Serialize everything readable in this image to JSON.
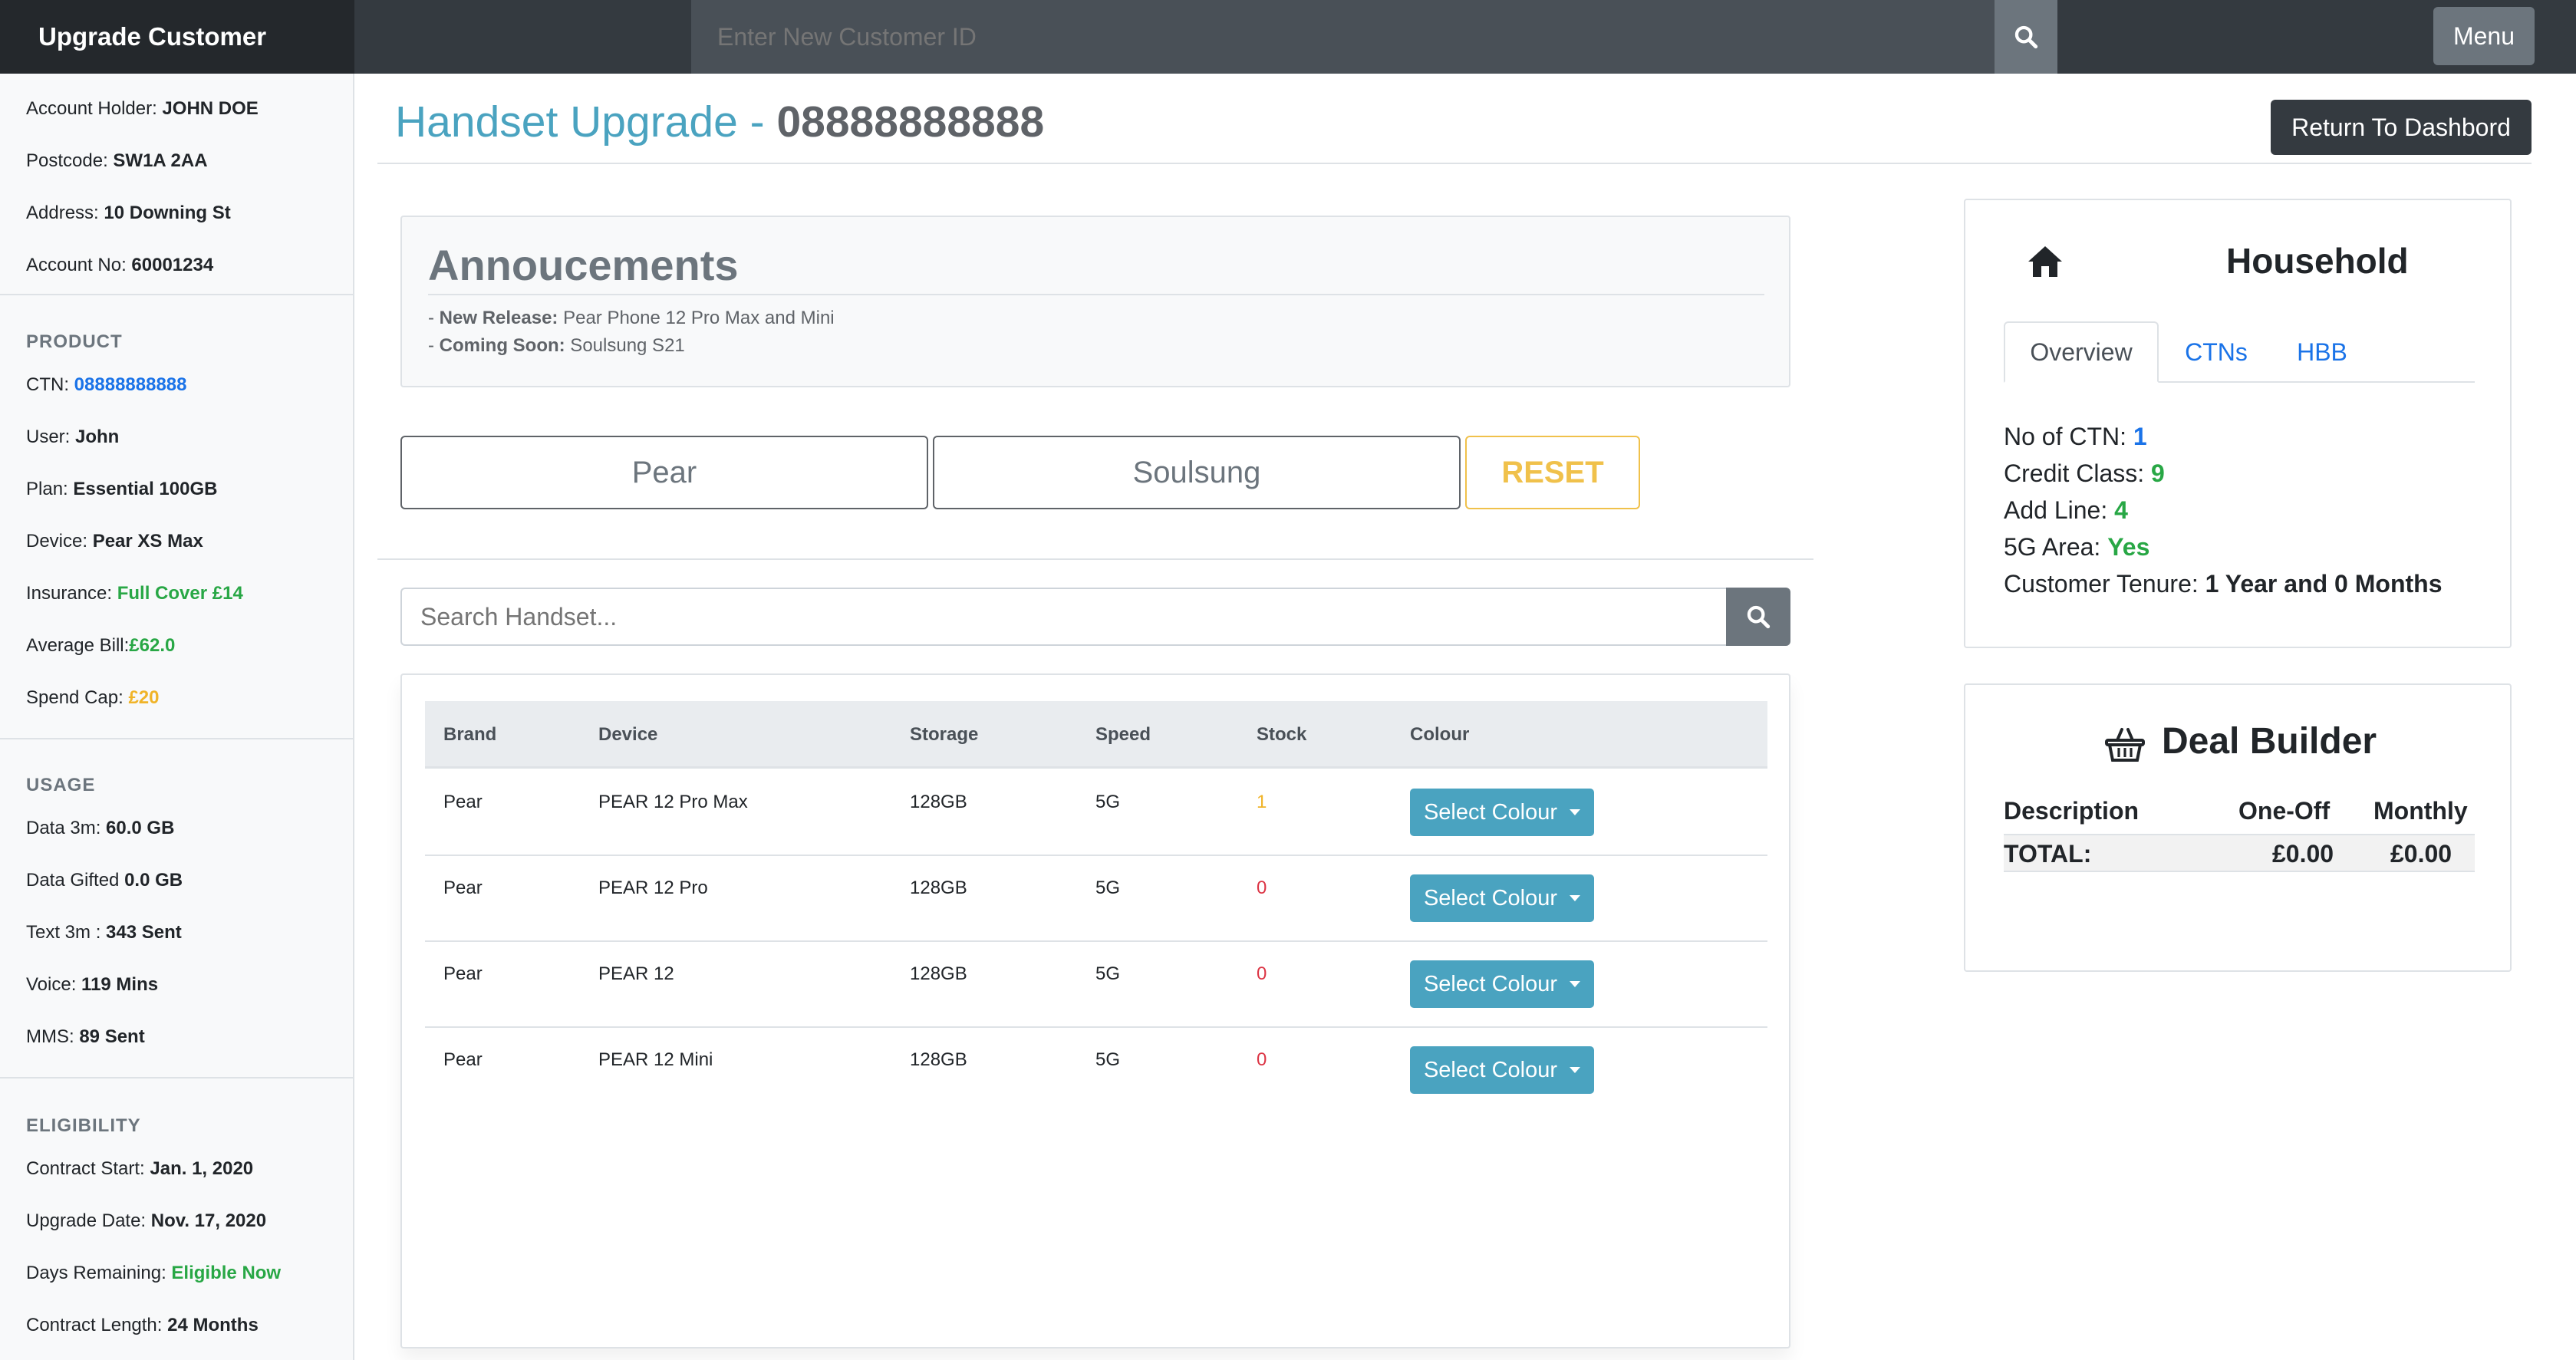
{
  "navbar": {
    "brand": "Upgrade Customer",
    "search_placeholder": "Enter New Customer ID",
    "menu_label": "Menu"
  },
  "sidebar": {
    "account": [
      {
        "label": "Account Holder: ",
        "value": "JOHN DOE"
      },
      {
        "label": "Postcode: ",
        "value": "SW1A 2AA"
      },
      {
        "label": "Address: ",
        "value": "10 Downing St"
      },
      {
        "label": "Account No: ",
        "value": "60001234"
      }
    ],
    "product_heading": "PRODUCT",
    "product": [
      {
        "label": "CTN: ",
        "value": "08888888888"
      },
      {
        "label": "User: ",
        "value": "John"
      },
      {
        "label": "Plan: ",
        "value": "Essential 100GB"
      },
      {
        "label": "Device: ",
        "value": "Pear XS Max"
      },
      {
        "label": "Insurance: ",
        "value": "Full Cover £14"
      },
      {
        "label": "Average Bill:",
        "value": "£62.0"
      },
      {
        "label": "Spend Cap: ",
        "value": "£20"
      }
    ],
    "usage_heading": "USAGE",
    "usage": [
      {
        "label": "Data 3m: ",
        "value": "60.0 GB"
      },
      {
        "label": "Data Gifted ",
        "value": "0.0 GB"
      },
      {
        "label": "Text 3m : ",
        "value": "343 Sent"
      },
      {
        "label": "Voice: ",
        "value": "119 Mins"
      },
      {
        "label": "MMS: ",
        "value": "89 Sent"
      }
    ],
    "eligibility_heading": "ELIGIBILITY",
    "eligibility": [
      {
        "label": "Contract Start: ",
        "value": "Jan. 1, 2020"
      },
      {
        "label": "Upgrade Date: ",
        "value": "Nov. 17, 2020"
      },
      {
        "label": "Days Remaining: ",
        "value": "Eligible Now"
      },
      {
        "label": "Contract Length: ",
        "value": "24 Months"
      }
    ]
  },
  "header": {
    "title_prefix": "Handset Upgrade - ",
    "title_number": "08888888888",
    "return_label": "Return To Dashbord"
  },
  "announcements": {
    "title": "Annoucements",
    "lines": [
      {
        "prefix": "- ",
        "label": "New Release:",
        "text": " Pear Phone 12 Pro Max and Mini"
      },
      {
        "prefix": "- ",
        "label": "Coming Soon:",
        "text": " Soulsung S21"
      }
    ]
  },
  "brand_filters": {
    "pear": "Pear",
    "soulsung": "Soulsung",
    "reset": "RESET"
  },
  "handset_search": {
    "placeholder": "Search Handset..."
  },
  "table": {
    "columns": [
      "Brand",
      "Device",
      "Storage",
      "Speed",
      "Stock",
      "Colour"
    ],
    "rows": [
      {
        "brand": "Pear",
        "device": "PEAR 12 Pro Max",
        "storage": "128GB",
        "speed": "5G",
        "stock": "1",
        "colour_label": "Select Colour"
      },
      {
        "brand": "Pear",
        "device": "PEAR 12 Pro",
        "storage": "128GB",
        "speed": "5G",
        "stock": "0",
        "colour_label": "Select Colour"
      },
      {
        "brand": "Pear",
        "device": "PEAR 12",
        "storage": "128GB",
        "speed": "5G",
        "stock": "0",
        "colour_label": "Select Colour"
      },
      {
        "brand": "Pear",
        "device": "PEAR 12 Mini",
        "storage": "128GB",
        "speed": "5G",
        "stock": "0",
        "colour_label": "Select Colour"
      }
    ]
  },
  "household": {
    "title": "Household",
    "tabs": [
      "Overview",
      "CTNs",
      "HBB"
    ],
    "rows": [
      {
        "label": "No of CTN: ",
        "value": "1"
      },
      {
        "label": "Credit Class: ",
        "value": "9"
      },
      {
        "label": "Add Line: ",
        "value": "4"
      },
      {
        "label": "5G Area: ",
        "value": "Yes"
      },
      {
        "label": "Customer Tenure: ",
        "value": "1 Year and 0 Months"
      }
    ]
  },
  "deal_builder": {
    "title": "Deal Builder",
    "columns": [
      "Description",
      "One-Off",
      "Monthly"
    ],
    "total_label": "TOTAL:",
    "total_oneoff": "£0.00",
    "total_monthly": "£0.00"
  },
  "colors": {
    "teal": "#4aa3c0",
    "link_blue": "#1a73e8",
    "green": "#28a745",
    "yellow": "#f0b429",
    "red": "#dc3545",
    "navbar": "#343a40"
  }
}
